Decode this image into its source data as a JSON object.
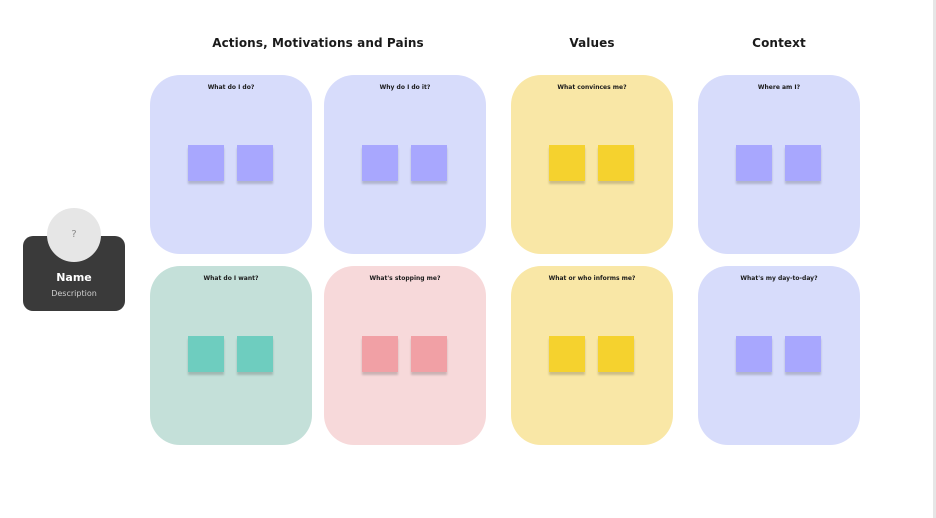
{
  "sections": {
    "actions": "Actions, Motivations and Pains",
    "values": "Values",
    "context": "Context"
  },
  "persona": {
    "avatar_placeholder": "?",
    "name": "Name",
    "description": "Description"
  },
  "cards": {
    "what_do_i_do": "What do I do?",
    "why_do_i_do_it": "Why do I do it?",
    "what_convinces_me": "What convinces me?",
    "where_am_i": "Where am I?",
    "what_do_i_want": "What do I want?",
    "whats_stopping_me": "What's stopping me?",
    "what_or_who_informs_me": "What or who informs me?",
    "whats_my_day_to_day": "What's my day-to-day?"
  },
  "colors": {
    "purple_card": "#d7dcfb",
    "purple_sticky": "#a8a7fe",
    "yellow_card": "#f9e7a6",
    "yellow_sticky": "#f5d22e",
    "green_card": "#c4e0d9",
    "green_sticky": "#6ecdbf",
    "pink_card": "#f7d9da",
    "pink_sticky": "#f1a0a5",
    "persona_card": "#3a3a3a"
  }
}
